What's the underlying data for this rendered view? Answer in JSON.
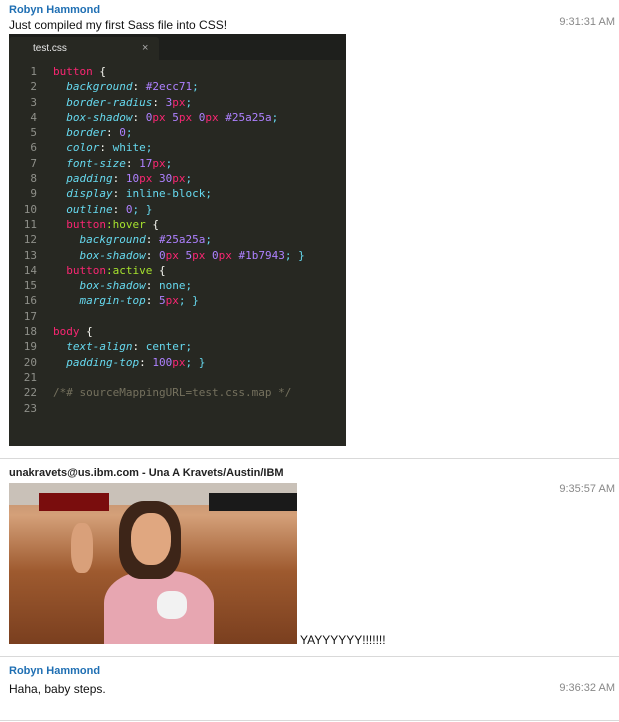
{
  "messages": [
    {
      "sender": "Robyn Hammond",
      "text": "Just compiled my first Sass file into CSS!",
      "time": "9:31:31 AM"
    },
    {
      "sender": "unakravets@us.ibm.com - Una A Kravets/Austin/IBM",
      "text": "YAYYYYYY!!!!!!!",
      "time": "9:35:57 AM"
    },
    {
      "sender": "Robyn Hammond",
      "text": "Haha, baby steps.",
      "time": "9:36:32 AM"
    }
  ],
  "editor": {
    "tab_label": "test.css",
    "close_glyph": "×",
    "lines": [
      "button {",
      "  background: #2ecc71;",
      "  border-radius: 3px;",
      "  box-shadow: 0px 5px 0px #25a25a;",
      "  border: 0;",
      "  color: white;",
      "  font-size: 17px;",
      "  padding: 10px 30px;",
      "  display: inline-block;",
      "  outline: 0; }",
      "  button:hover {",
      "    background: #25a25a;",
      "    box-shadow: 0px 5px 0px #1b7943; }",
      "  button:active {",
      "    box-shadow: none;",
      "    margin-top: 5px; }",
      "",
      "body {",
      "  text-align: center;",
      "  padding-top: 100px; }",
      "",
      "/*# sourceMappingURL=test.css.map */",
      ""
    ]
  },
  "colors": {
    "sender": "#1f6fb3",
    "editor_bg": "#272822",
    "selector": "#f92672",
    "property": "#66d9ef",
    "number": "#ae81ff",
    "pseudo": "#a6e22e",
    "comment": "#75715e"
  }
}
